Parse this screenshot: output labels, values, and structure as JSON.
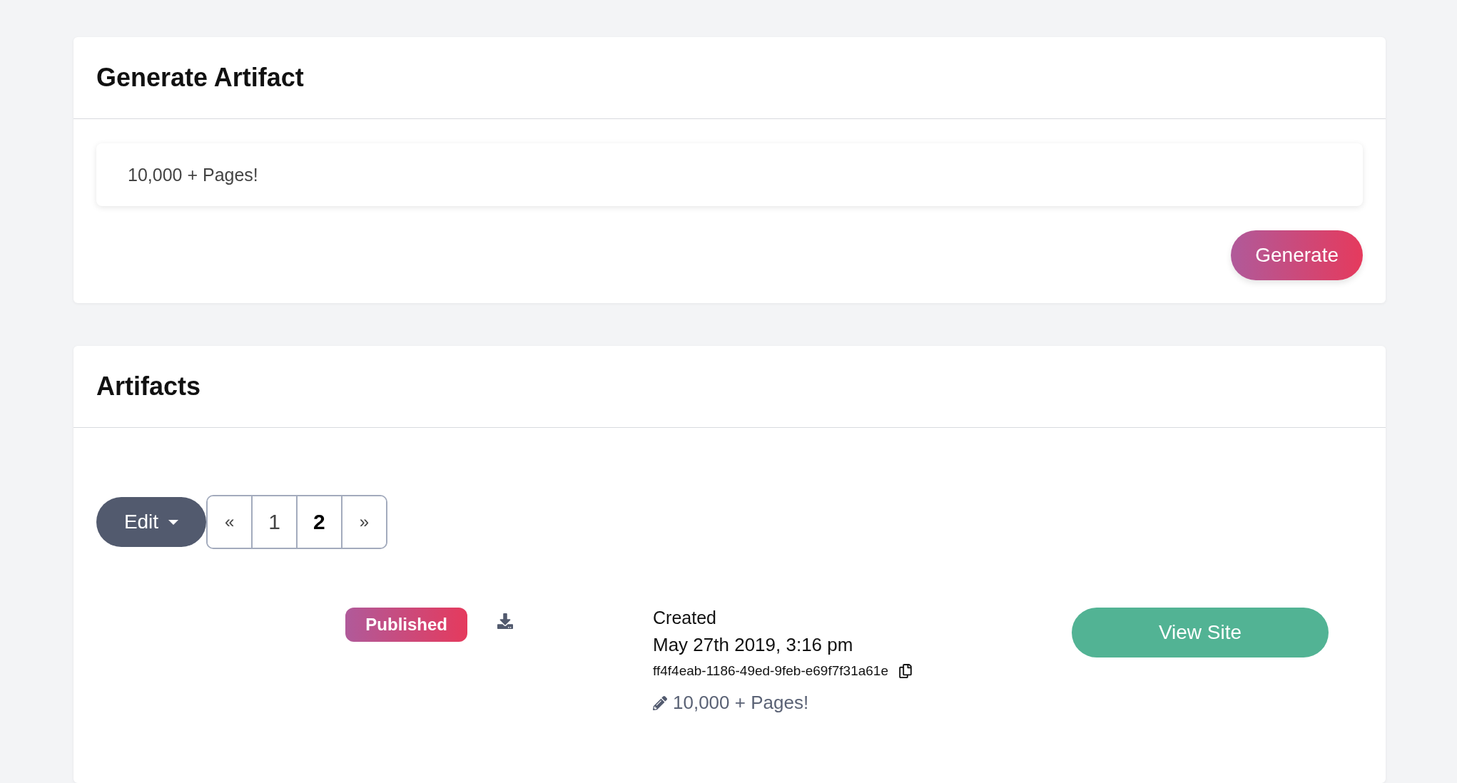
{
  "generate_card": {
    "title": "Generate Artifact",
    "input": {
      "value": "10,000 + Pages!"
    },
    "button": "Generate"
  },
  "artifacts_card": {
    "title": "Artifacts",
    "edit_menu": {
      "label": "Edit",
      "expanded": false
    },
    "pagination": [
      {
        "label": "«",
        "kind": "prev",
        "selected": false
      },
      {
        "label": "1",
        "kind": "page",
        "selected": false
      },
      {
        "label": "2",
        "kind": "page",
        "selected": true
      },
      {
        "label": "»",
        "kind": "next",
        "selected": false
      }
    ],
    "items": [
      {
        "status": "Published",
        "created_label": "Created",
        "created": "May 27th 2019, 3:16 pm",
        "id": "ff4f4eab-1186-49ed-9feb-e69f7f31a61e",
        "description": "10,000 + Pages!",
        "action": "View Site"
      }
    ]
  }
}
